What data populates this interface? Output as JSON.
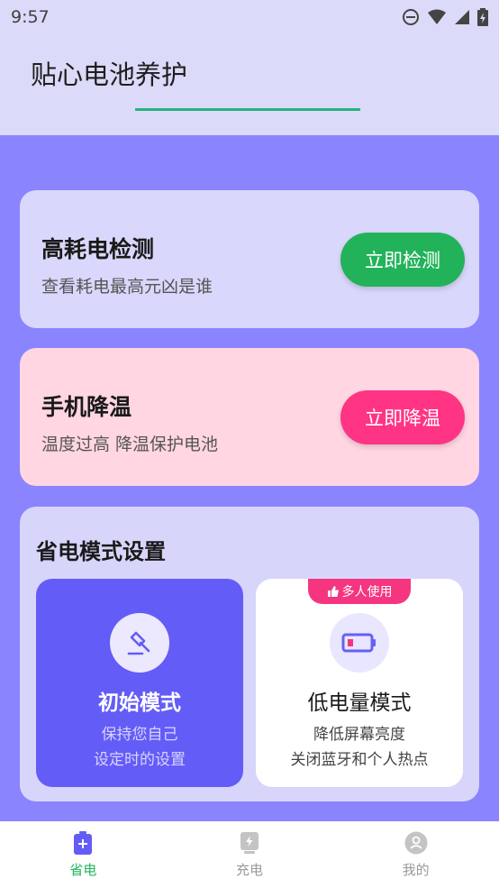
{
  "status_bar": {
    "time": "9:57"
  },
  "app": {
    "title": "贴心电池养护"
  },
  "detect_card": {
    "title": "高耗电检测",
    "subtitle": "查看耗电最高元凶是谁",
    "button": "立即检测"
  },
  "cool_card": {
    "title": "手机降温",
    "subtitle": "温度过高 降温保护电池",
    "button": "立即降温"
  },
  "mode_section": {
    "title": "省电模式设置",
    "modes": [
      {
        "name": "初始模式",
        "desc1": "保持您自己",
        "desc2": "设定时的设置"
      },
      {
        "name": "低电量模式",
        "desc1": "降低屏幕亮度",
        "desc2": "关闭蓝牙和个人热点",
        "badge": "多人使用"
      }
    ]
  },
  "tabs": [
    {
      "label": "省电",
      "icon": "battery-plus-icon",
      "active": true
    },
    {
      "label": "充电",
      "icon": "charging-icon",
      "active": false
    },
    {
      "label": "我的",
      "icon": "profile-icon",
      "active": false
    }
  ],
  "colors": {
    "background": "#8a84ff",
    "header": "#dcdaf9",
    "green": "#22b35a",
    "pink": "#ff3484",
    "purple": "#645cf7"
  }
}
